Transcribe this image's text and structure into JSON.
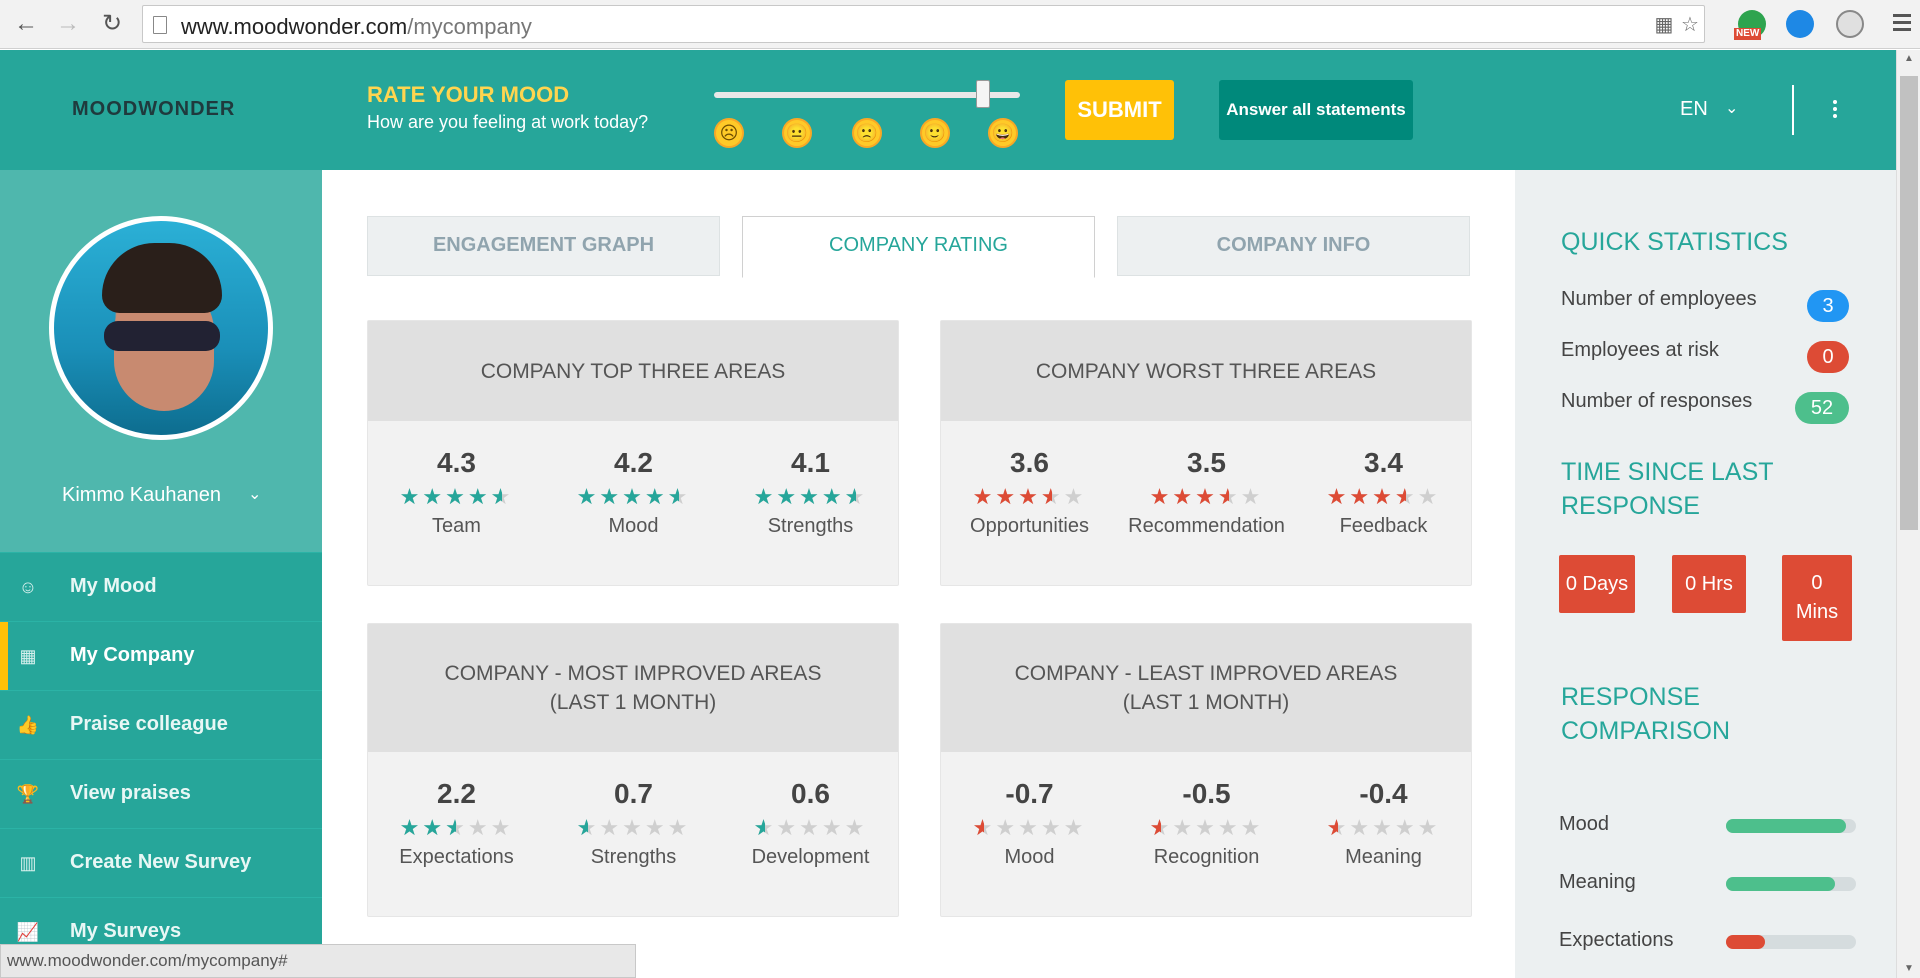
{
  "browser": {
    "url_host": "www.moodwonder.com",
    "url_path": "/mycompany",
    "status_url": "www.moodwonder.com/mycompany#",
    "ext_new_badge": "NEW"
  },
  "header": {
    "logo": "MOODWONDER",
    "rate_title": "RATE YOUR MOOD",
    "rate_subtitle": "How are you feeling at work today?",
    "mood_level": 0.88,
    "emojis": [
      "☹",
      "😐",
      "🙁",
      "🙂",
      "😀"
    ],
    "submit_label": "SUBMIT",
    "answer_label": "Answer all statements",
    "language": "EN"
  },
  "sidebar": {
    "user_name": "Kimmo Kauhanen",
    "items": [
      {
        "label": "My Mood",
        "icon": "☺",
        "active": false
      },
      {
        "label": "My Company",
        "icon": "▦",
        "active": true
      },
      {
        "label": "Praise colleague",
        "icon": "👍",
        "active": false
      },
      {
        "label": "View praises",
        "icon": "🏆",
        "active": false
      },
      {
        "label": "Create New Survey",
        "icon": "▥",
        "active": false
      },
      {
        "label": "My Surveys",
        "icon": "📈",
        "active": false
      }
    ]
  },
  "tabs": [
    {
      "label": "ENGAGEMENT GRAPH",
      "active": false
    },
    {
      "label": "COMPANY RATING",
      "active": true
    },
    {
      "label": "COMPANY INFO",
      "active": false
    }
  ],
  "colors": {
    "teal": "#26a69a",
    "green_star": "#26a69a",
    "red_star": "#dd4b35",
    "badge_blue": "#2196f3",
    "badge_red": "#dd4b35",
    "badge_green": "#4dbf8c"
  },
  "cards": [
    {
      "title_lines": [
        "COMPANY TOP THREE AREAS"
      ],
      "star_color": "green",
      "metrics": [
        {
          "value": "4.3",
          "rating": 4.3,
          "label": "Team"
        },
        {
          "value": "4.2",
          "rating": 4.2,
          "label": "Mood"
        },
        {
          "value": "4.1",
          "rating": 4.1,
          "label": "Strengths"
        }
      ]
    },
    {
      "title_lines": [
        "COMPANY WORST THREE AREAS"
      ],
      "star_color": "red",
      "metrics": [
        {
          "value": "3.6",
          "rating": 3.6,
          "label": "Opportunities"
        },
        {
          "value": "3.5",
          "rating": 3.5,
          "label": "Recommendation"
        },
        {
          "value": "3.4",
          "rating": 3.4,
          "label": "Feedback"
        }
      ]
    },
    {
      "title_lines": [
        "COMPANY - MOST IMPROVED AREAS",
        "(LAST 1 MONTH)"
      ],
      "star_color": "green",
      "metrics": [
        {
          "value": "2.2",
          "rating": 2.5,
          "label": "Expectations"
        },
        {
          "value": "0.7",
          "rating": 0.5,
          "label": "Strengths"
        },
        {
          "value": "0.6",
          "rating": 0.5,
          "label": "Development"
        }
      ]
    },
    {
      "title_lines": [
        "COMPANY - LEAST IMPROVED AREAS",
        "(LAST 1 MONTH)"
      ],
      "star_color": "red",
      "metrics": [
        {
          "value": "-0.7",
          "rating": 0.5,
          "label": "Mood"
        },
        {
          "value": "-0.5",
          "rating": 0.5,
          "label": "Recognition"
        },
        {
          "value": "-0.4",
          "rating": 0.5,
          "label": "Meaning"
        }
      ]
    }
  ],
  "quick_stats": {
    "title": "QUICK STATISTICS",
    "items": [
      {
        "label": "Number of employees",
        "value": "3",
        "color": "#2196f3"
      },
      {
        "label": "Employees at risk",
        "value": "0",
        "color": "#dd4b35"
      },
      {
        "label": "Number of responses",
        "value": "52",
        "color": "#4dbf8c"
      }
    ]
  },
  "time_since": {
    "title_lines": [
      "TIME SINCE LAST",
      "RESPONSE"
    ],
    "boxes": [
      {
        "lines": [
          "0 Days"
        ]
      },
      {
        "lines": [
          "0 Hrs"
        ]
      },
      {
        "lines": [
          "0",
          "Mins"
        ]
      }
    ]
  },
  "response_comparison": {
    "title_lines": [
      "RESPONSE",
      "COMPARISON"
    ],
    "items": [
      {
        "label": "Mood",
        "level": 0.92,
        "color": "#4dbf8c"
      },
      {
        "label": "Meaning",
        "level": 0.84,
        "color": "#4dbf8c"
      },
      {
        "label": "Expectations",
        "level": 0.3,
        "color": "#dd4b35"
      }
    ]
  }
}
